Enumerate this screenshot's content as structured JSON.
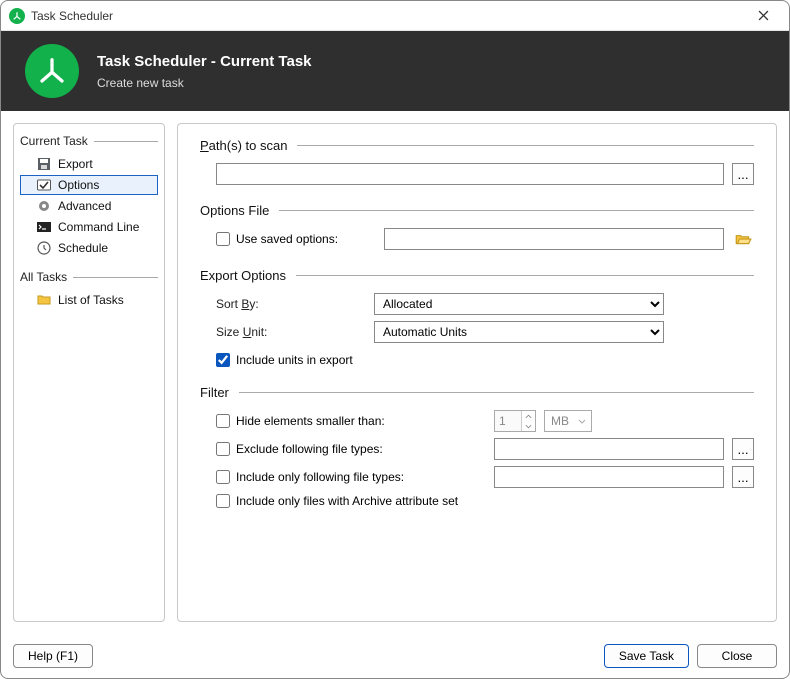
{
  "window": {
    "title": "Task Scheduler"
  },
  "header": {
    "title": "Task Scheduler - Current Task",
    "subtitle": "Create new task"
  },
  "nav": {
    "currentTask": {
      "header": "Current Task",
      "items": [
        {
          "label": "Export"
        },
        {
          "label": "Options"
        },
        {
          "label": "Advanced"
        },
        {
          "label": "Command Line"
        },
        {
          "label": "Schedule"
        }
      ]
    },
    "allTasks": {
      "header": "All Tasks",
      "items": [
        {
          "label": "List of Tasks"
        }
      ]
    }
  },
  "sections": {
    "paths": {
      "header_prefix": "P",
      "header_rest": "ath(s) to scan",
      "value": "",
      "browse": "..."
    },
    "optionsFile": {
      "header": "Options File",
      "checkbox": "Use saved options:",
      "value": ""
    },
    "exportOptions": {
      "header": "Export Options",
      "sortBy": {
        "label_prefix": "Sort ",
        "label_ul": "B",
        "label_rest": "y:",
        "value": "Allocated"
      },
      "sizeUnit": {
        "label_prefix": "Size ",
        "label_ul": "U",
        "label_rest": "nit:",
        "value": "Automatic Units"
      },
      "includeUnits": {
        "label": "Include units in export",
        "checked": true
      }
    },
    "filter": {
      "header": "Filter",
      "hideSmaller": {
        "label": "Hide elements smaller than:",
        "value": "1",
        "unit": "MB"
      },
      "excludeTypes": {
        "label": "Exclude following file types:",
        "value": "",
        "browse": "..."
      },
      "includeTypes": {
        "label": "Include only following file types:",
        "value": "",
        "browse": "..."
      },
      "archiveOnly": {
        "label": "Include only files with Archive attribute set"
      }
    }
  },
  "footer": {
    "help": "Help (F1)",
    "save": "Save Task",
    "close": "Close"
  }
}
